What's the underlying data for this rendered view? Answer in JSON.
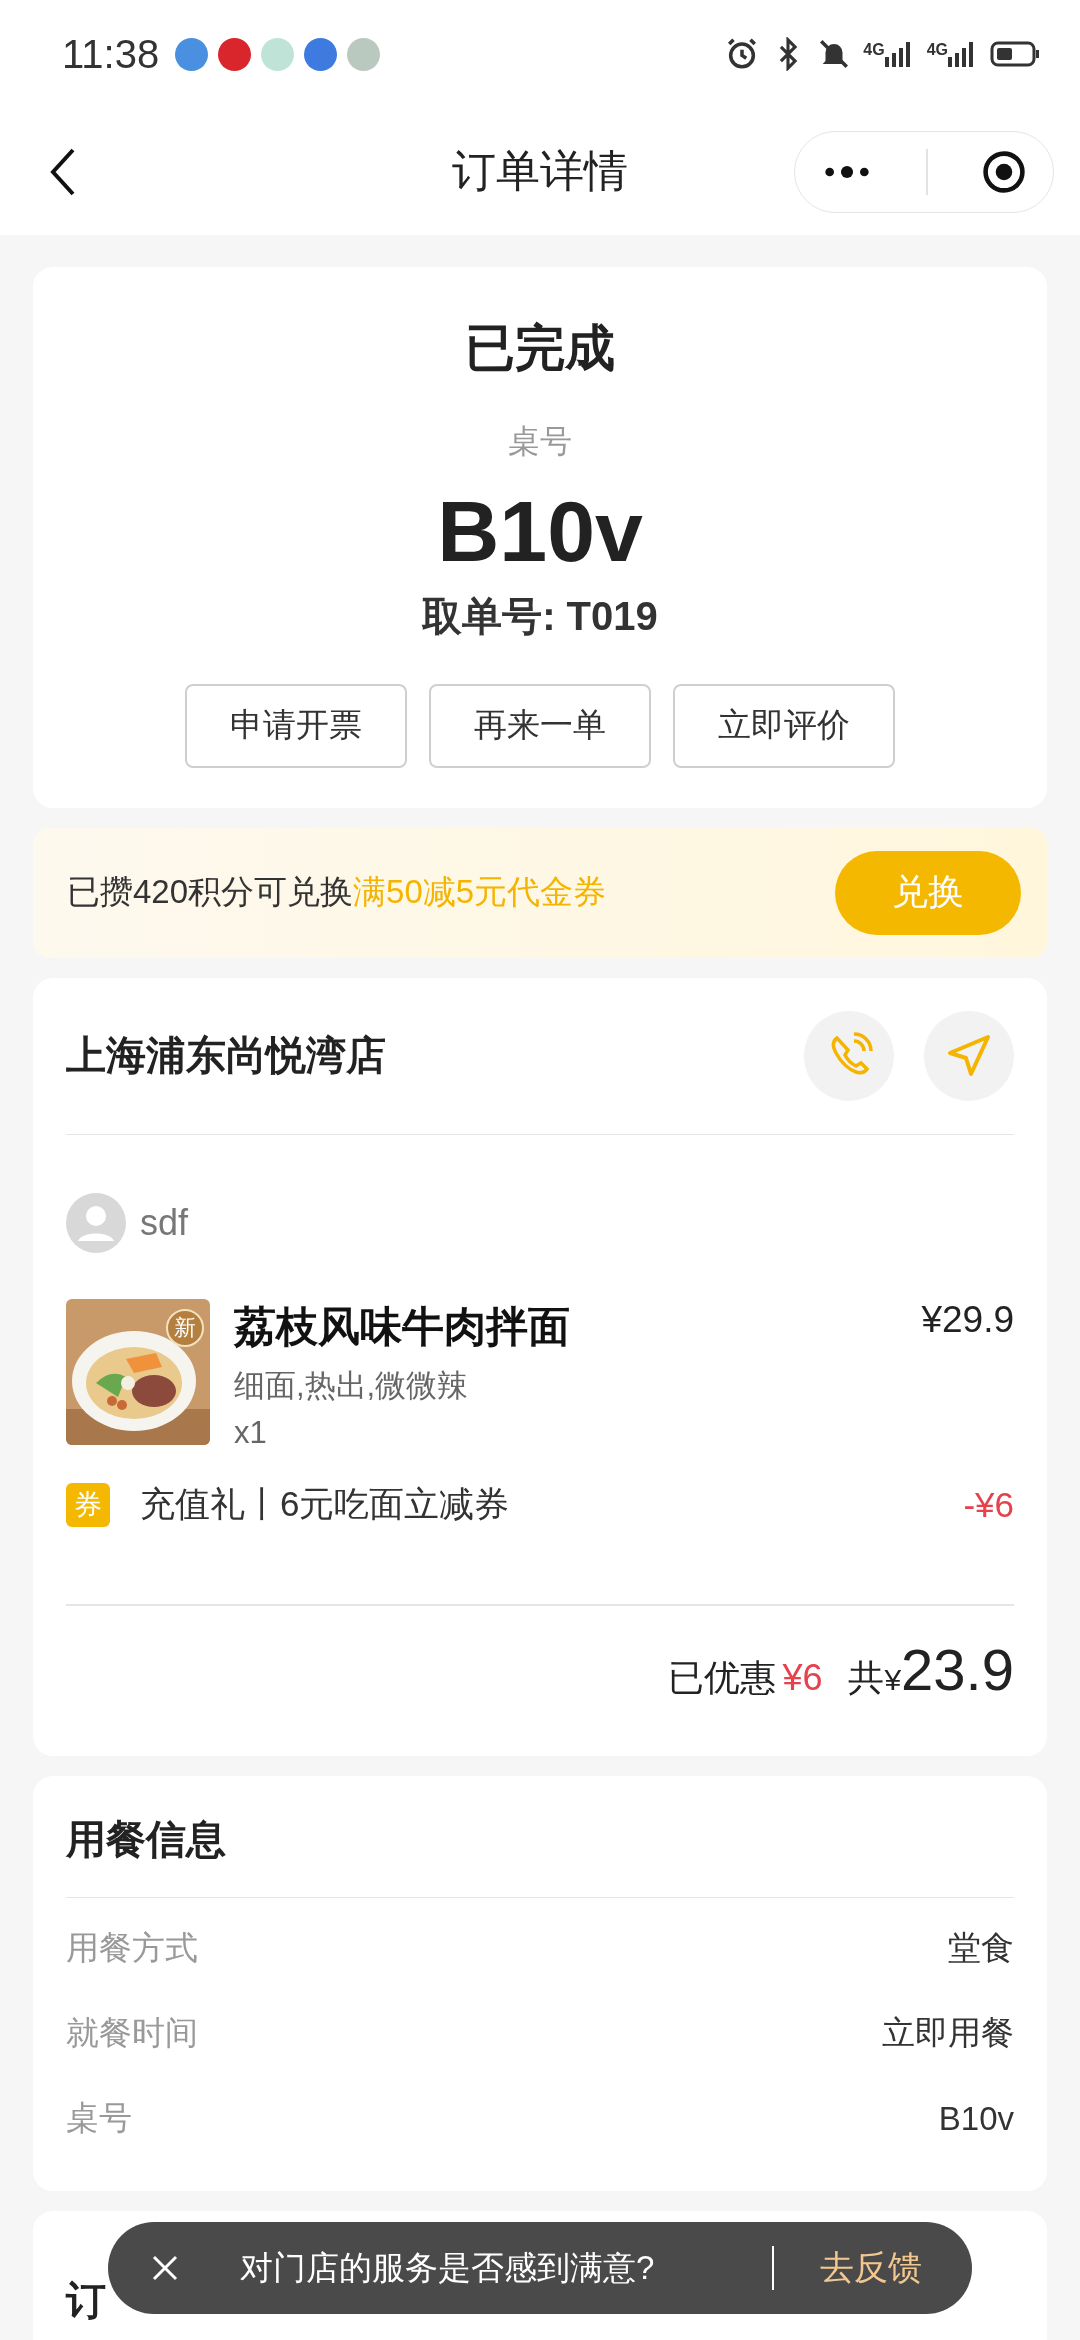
{
  "status_bar": {
    "time": "11:38",
    "network_labels": [
      "4G",
      "4G"
    ]
  },
  "nav": {
    "title": "订单详情"
  },
  "status_card": {
    "status": "已完成",
    "table_label": "桌号",
    "table_number": "B10v",
    "pickup": "取单号: T019",
    "buttons": [
      "申请开票",
      "再来一单",
      "立即评价"
    ]
  },
  "points_banner": {
    "text": "已攒420积分可兑换",
    "highlight": "满50减5元代金券",
    "button": "兑换"
  },
  "store": {
    "name": "上海浦东尚悦湾店",
    "user": "sdf",
    "items": [
      {
        "name": "荔枝风味牛肉拌面",
        "options": "细面,热出,微微辣",
        "quantity": "x1",
        "price": "¥29.9",
        "badge": "新"
      }
    ],
    "coupon": {
      "tag": "券",
      "text": "充值礼丨6元吃面立减券",
      "amount": "-¥6"
    },
    "discount_label": "已优惠",
    "discount": "¥6",
    "total_label": "共",
    "currency": "¥",
    "total": "23.9"
  },
  "dining_info": {
    "title": "用餐信息",
    "rows": [
      {
        "label": "用餐方式",
        "value": "堂食"
      },
      {
        "label": "就餐时间",
        "value": "立即用餐"
      },
      {
        "label": "桌号",
        "value": "B10v"
      }
    ]
  },
  "order_info": {
    "title": "订"
  },
  "toast": {
    "text": "对门店的服务是否感到满意?",
    "action": "去反馈"
  }
}
